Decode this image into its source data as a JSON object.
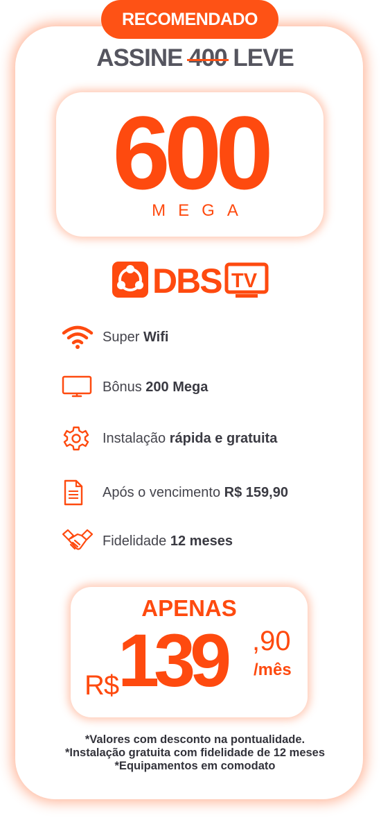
{
  "badge": "RECOMENDADO",
  "promo": {
    "prefix": "ASSINE",
    "old_speed": "400",
    "suffix": "LEVE"
  },
  "speed": {
    "value": "600",
    "unit": "MEGA"
  },
  "logo": {
    "brand": "DBS",
    "tv": "TV"
  },
  "features": [
    {
      "icon": "wifi-icon",
      "text": "Super",
      "bold": "Wifi"
    },
    {
      "icon": "monitor-icon",
      "text": "Bônus",
      "bold": "200 Mega"
    },
    {
      "icon": "gear-icon",
      "text": "Instalação",
      "bold": "rápida e gratuita"
    },
    {
      "icon": "document-icon",
      "text": "Após o vencimento",
      "bold": "R$ 159,90"
    },
    {
      "icon": "handshake-icon",
      "text": "Fidelidade",
      "bold": "12 meses"
    }
  ],
  "price": {
    "label": "APENAS",
    "currency": "R$",
    "integer": "139",
    "cents": ",90",
    "period": "/mês"
  },
  "notes": [
    "*Valores com desconto na pontualidade.",
    "*Instalação gratuita com fidelidade de 12 meses",
    "*Equipamentos em comodato"
  ],
  "colors": {
    "accent": "#fe5215",
    "text": "#44444c"
  }
}
